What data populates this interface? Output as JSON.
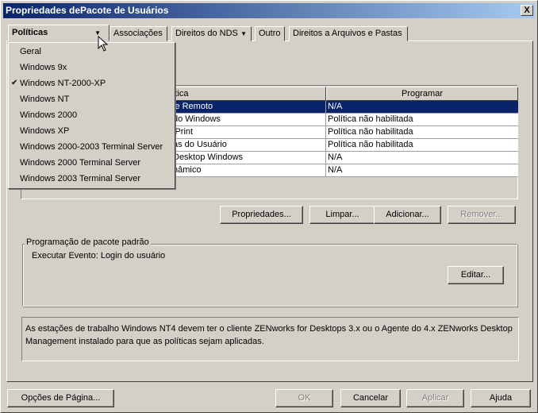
{
  "window": {
    "title": "Propriedades dePacote de Usuários",
    "close": "X"
  },
  "tabs": [
    {
      "label": "Políticas",
      "arrow": "▼"
    },
    {
      "label": "Associações"
    },
    {
      "label": "Direitos do NDS",
      "arrow": "▼"
    },
    {
      "label": "Outro"
    },
    {
      "label": "Direitos a Arquivos e Pastas"
    }
  ],
  "menu": {
    "items": [
      "Geral",
      "Windows 9x",
      "Windows NT-2000-XP",
      "Windows NT",
      "Windows 2000",
      "Windows XP",
      "Windows 2000-2003 Terminal Server",
      "Windows 2000 Terminal Server",
      "Windows 2003 Terminal Server"
    ],
    "checked_index": 2,
    "check": "✔"
  },
  "table": {
    "headers": [
      "Política",
      "Programar"
    ],
    "rows": [
      {
        "policy": "le Remoto",
        "schedule": "N/A",
        "selected": true
      },
      {
        "policy": "do Windows",
        "schedule": "Política não habilitada"
      },
      {
        "policy": "iPrint",
        "schedule": "Política não habilitada"
      },
      {
        "policy": "as do Usuário",
        "schedule": "Política não habilitada"
      },
      {
        "policy": "Desktop Windows",
        "schedule": "N/A"
      },
      {
        "policy": "nâmico",
        "schedule": "N/A"
      }
    ]
  },
  "actions": {
    "properties": "Propriedades...",
    "clear": "Limpar...",
    "add": "Adicionar...",
    "remove": "Remover..."
  },
  "schedule_group": {
    "label": "Programação de pacote padrão",
    "text": "Executar Evento: Login do usuário",
    "edit": "Editar..."
  },
  "info": "As estações de trabalho Windows NT4 devem ter o cliente ZENworks for Desktops 3.x ou o Agente do 4.x ZENworks Desktop Management instalado para que as políticas sejam aplicadas.",
  "footer": {
    "page_options": "Opções de Página...",
    "ok": "OK",
    "cancel": "Cancelar",
    "apply": "Aplicar",
    "help": "Ajuda"
  }
}
